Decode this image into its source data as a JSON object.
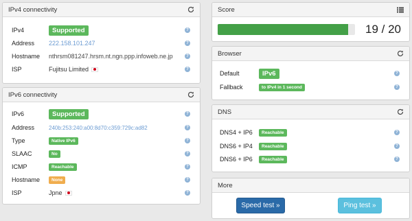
{
  "ipv4": {
    "title": "IPv4 connectivity",
    "rows": [
      {
        "label": "IPv4",
        "value": "Supported"
      },
      {
        "label": "Address",
        "value": "222.158.101.247"
      },
      {
        "label": "Hostname",
        "value": "nthrsm081247.hrsm.nt.ngn.ppp.infoweb.ne.jp"
      },
      {
        "label": "ISP",
        "value": "Fujitsu Limited"
      }
    ]
  },
  "ipv6": {
    "title": "IPv6 connectivity",
    "rows": [
      {
        "label": "IPv6",
        "value": "Supported"
      },
      {
        "label": "Address",
        "value": "240b:253:240:a00:8d70:c359:729c:ad82"
      },
      {
        "label": "Type",
        "value": "Native IPv6"
      },
      {
        "label": "SLAAC",
        "value": "No"
      },
      {
        "label": "ICMP",
        "value": "Reachable"
      },
      {
        "label": "Hostname",
        "value": "None"
      },
      {
        "label": "ISP",
        "value": "Jpne"
      }
    ]
  },
  "score": {
    "title": "Score",
    "value_text": "19 / 20",
    "progress_fraction": 0.95
  },
  "browser": {
    "title": "Browser",
    "rows": [
      {
        "label": "Default",
        "value": "IPv6"
      },
      {
        "label": "Fallback",
        "value": "to IPv4 in 1 second"
      }
    ]
  },
  "dns": {
    "title": "DNS",
    "rows": [
      {
        "label": "DNS4 + IP6",
        "value": "Reachable"
      },
      {
        "label": "DNS6 + IP4",
        "value": "Reachable"
      },
      {
        "label": "DNS6 + IP6",
        "value": "Reachable"
      }
    ]
  },
  "more": {
    "title": "More",
    "speed_test_label": "Speed test »",
    "ping_test_label": "Ping test »"
  },
  "colors": {
    "success": "#5cb85c",
    "warning": "#f0ad4e",
    "progress": "#43a047",
    "primary_button": "#2a6aa8",
    "info_button": "#5bc0de",
    "link": "#6b9bd2"
  },
  "icons": {
    "refresh": "refresh-icon",
    "list": "list-icon",
    "help": "help-icon",
    "flag": "japan-flag-icon"
  }
}
